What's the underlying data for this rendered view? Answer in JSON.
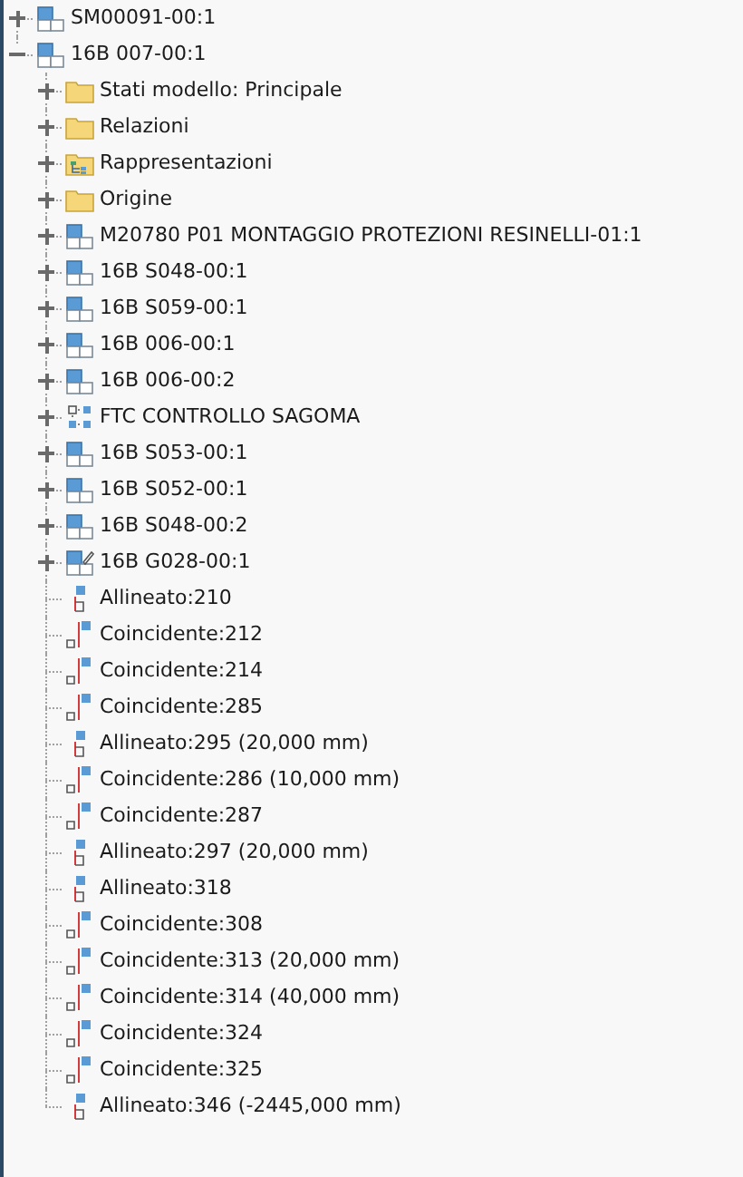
{
  "tree": [
    {
      "label": "SM00091-00:1",
      "kind": "part",
      "expanded": false
    },
    {
      "label": "16B 007-00:1",
      "kind": "part",
      "expanded": true,
      "children": [
        {
          "label": "Stati modello: Principale",
          "kind": "folder",
          "expanded": false
        },
        {
          "label": "Relazioni",
          "kind": "folder",
          "expanded": false
        },
        {
          "label": "Rappresentazioni",
          "kind": "representations",
          "expanded": false
        },
        {
          "label": "Origine",
          "kind": "folder",
          "expanded": false
        },
        {
          "label": "M20780 P01 MONTAGGIO PROTEZIONI RESINELLI-01:1",
          "kind": "part",
          "expanded": false
        },
        {
          "label": "16B S048-00:1",
          "kind": "part",
          "expanded": false
        },
        {
          "label": "16B S059-00:1",
          "kind": "part",
          "expanded": false
        },
        {
          "label": "16B 006-00:1",
          "kind": "part",
          "expanded": false
        },
        {
          "label": "16B 006-00:2",
          "kind": "part",
          "expanded": false
        },
        {
          "label": "FTC CONTROLLO SAGOMA",
          "kind": "pattern",
          "expanded": false
        },
        {
          "label": "16B S053-00:1",
          "kind": "part",
          "expanded": false
        },
        {
          "label": "16B S052-00:1",
          "kind": "part",
          "expanded": false
        },
        {
          "label": "16B S048-00:2",
          "kind": "part",
          "expanded": false
        },
        {
          "label": "16B G028-00:1",
          "kind": "edited-part",
          "expanded": false
        },
        {
          "label": "Allineato:210",
          "kind": "aligned"
        },
        {
          "label": "Coincidente:212",
          "kind": "coincident"
        },
        {
          "label": "Coincidente:214",
          "kind": "coincident"
        },
        {
          "label": "Coincidente:285",
          "kind": "coincident"
        },
        {
          "label": "Allineato:295 (20,000 mm)",
          "kind": "aligned"
        },
        {
          "label": "Coincidente:286 (10,000 mm)",
          "kind": "coincident"
        },
        {
          "label": "Coincidente:287",
          "kind": "coincident"
        },
        {
          "label": "Allineato:297 (20,000 mm)",
          "kind": "aligned"
        },
        {
          "label": "Allineato:318",
          "kind": "aligned"
        },
        {
          "label": "Coincidente:308",
          "kind": "coincident"
        },
        {
          "label": "Coincidente:313 (20,000 mm)",
          "kind": "coincident"
        },
        {
          "label": "Coincidente:314 (40,000 mm)",
          "kind": "coincident"
        },
        {
          "label": "Coincidente:324",
          "kind": "coincident"
        },
        {
          "label": "Coincidente:325",
          "kind": "coincident"
        },
        {
          "label": "Allineato:346 (-2445,000 mm)",
          "kind": "aligned"
        }
      ]
    }
  ]
}
